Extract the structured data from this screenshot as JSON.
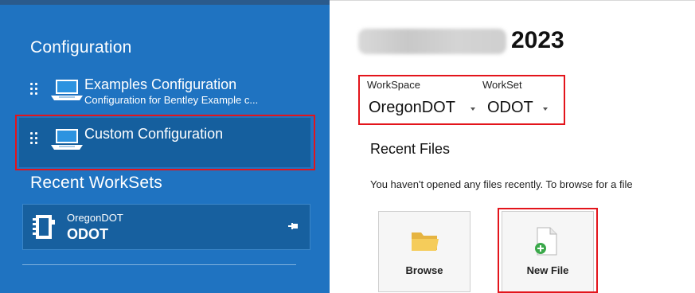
{
  "sidebar": {
    "configuration_heading": "Configuration",
    "configurations": [
      {
        "name": "Examples Configuration",
        "description": "Configuration for Bentley Example c..."
      },
      {
        "name": "Custom Configuration",
        "description": ""
      }
    ],
    "recent_worksets_heading": "Recent WorkSets",
    "recent_worksets": [
      {
        "workspace": "OregonDOT",
        "workset": "ODOT"
      }
    ]
  },
  "main": {
    "product_year": "2023",
    "workspace_label": "WorkSpace",
    "workspace_value": "OregonDOT",
    "workset_label": "WorkSet",
    "workset_value": "ODOT",
    "recent_files_heading": "Recent Files",
    "empty_message": "You haven't opened any files recently.  To browse for a file",
    "browse_label": "Browse",
    "new_file_label": "New File"
  },
  "colors": {
    "sidebar_bg": "#1f73c1",
    "highlight": "#e3141b"
  },
  "icons": [
    "drag-handle-icon",
    "laptop-icon",
    "workset-icon",
    "pin-icon",
    "caret-down-icon",
    "folder-icon",
    "new-file-icon"
  ]
}
